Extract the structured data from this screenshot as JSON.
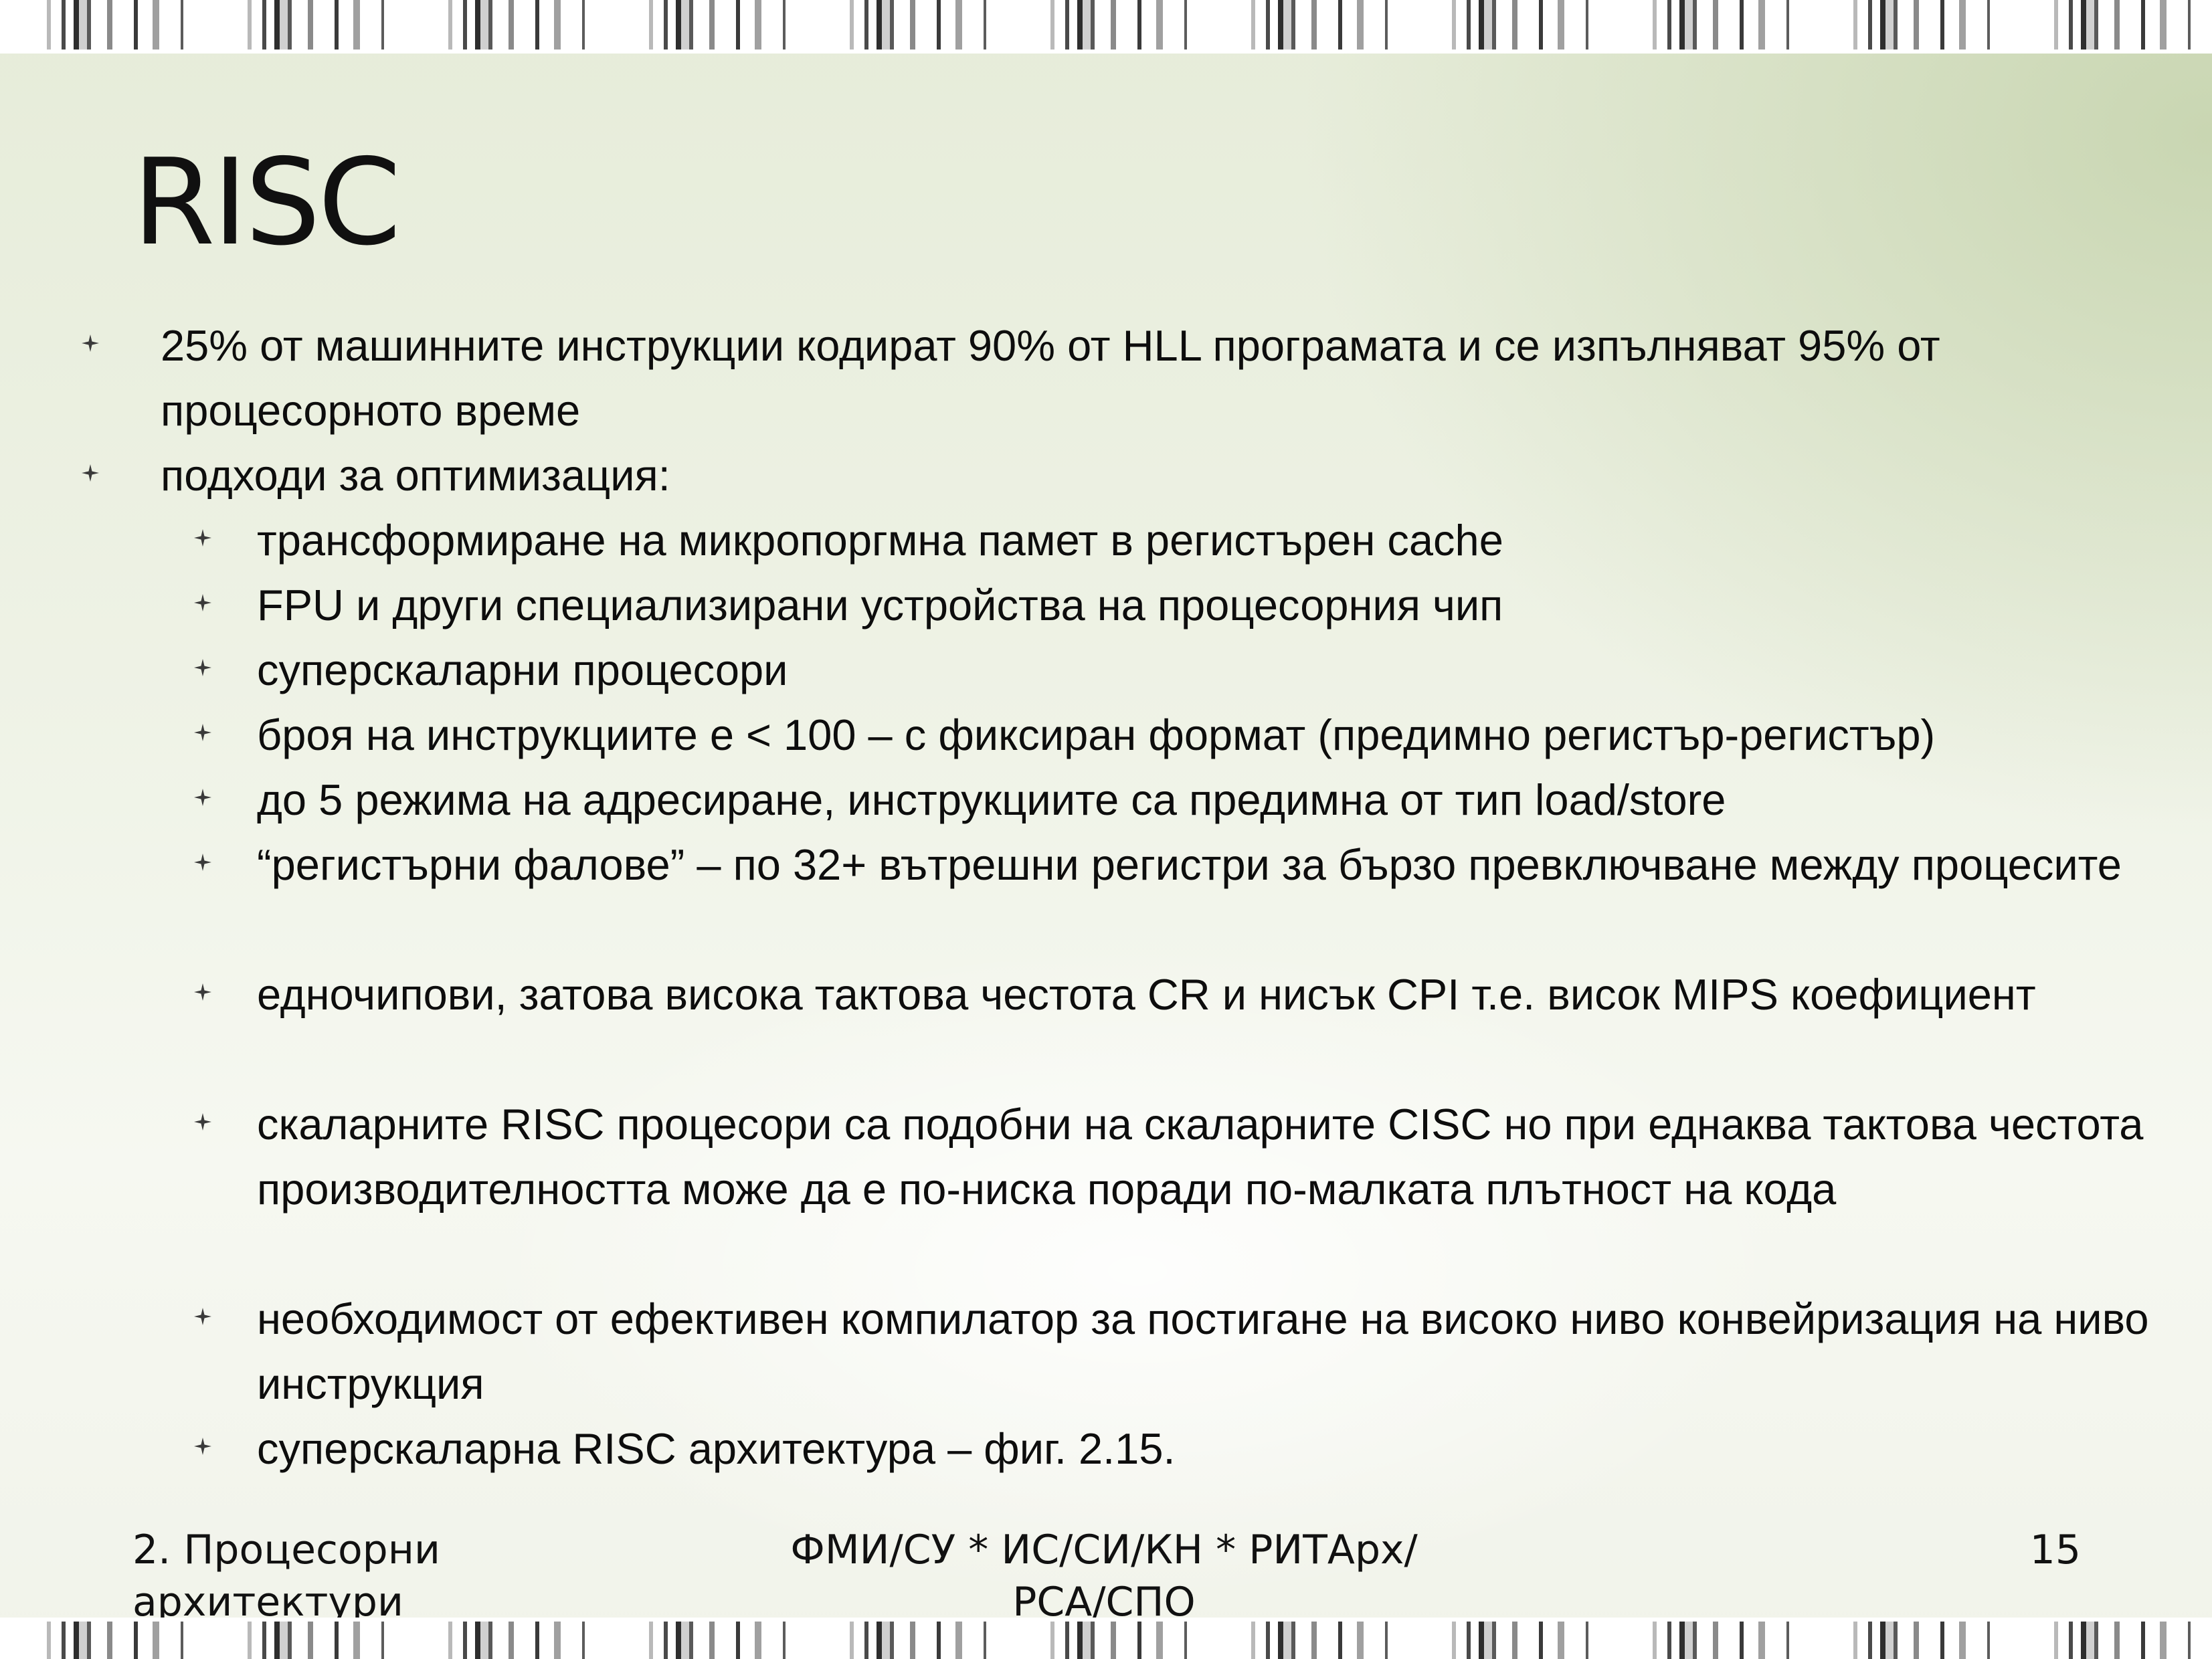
{
  "slide": {
    "title": "RISC",
    "bullets": [
      {
        "level": 1,
        "text": "25% от машинните инструкции кодират 90% от HLL програмата и се изпълняват 95% от процесорното време"
      },
      {
        "level": 1,
        "text": "подходи за оптимизация:"
      },
      {
        "level": 2,
        "text": "трансформиране на микропоргмна памет в регистърен cache"
      },
      {
        "level": 2,
        "text": "FPU и други специализирани устройства на процесорния чип"
      },
      {
        "level": 2,
        "text": "суперскаларни процесори"
      },
      {
        "level": 2,
        "text": "броя на инструкциите е < 100 – с фиксиран формат (предимно регистър-регистър)"
      },
      {
        "level": 2,
        "text": "до 5 режима на адресиране, инструкциите са предимна от тип load/store"
      },
      {
        "level": 2,
        "text": "“регистърни фалове” – по 32+ вътрешни регистри за бързо превключване между процесите"
      },
      {
        "level": 2,
        "text": "едночипови, затова висока тактова честота CR и нисък CPI т.е. висок MIPS коефициент"
      },
      {
        "level": 2,
        "text": "скаларните RISC процесори са подобни на скаларните CISC но при еднаква тактова честота производителността може да е по-ниска поради по-малката плътност на кода"
      },
      {
        "level": 2,
        "text": "необходимост от ефективен компилатор за постигане на високо ниво конвейризация на ниво инструкция"
      },
      {
        "level": 2,
        "text": "суперскаларна RISC архитектура – фиг. 2.15."
      }
    ]
  },
  "footer": {
    "left": "2. Процесорни архитектури",
    "center": "ФМИ/СУ * ИС/СИ/КН * РИТАрх/РСА/СПО",
    "page_number": "15"
  },
  "colors": {
    "bullet": "#3a3a3a",
    "text": "#0d0d0d"
  },
  "icons": {
    "bullet": "four-point-star-bullet-icon"
  }
}
